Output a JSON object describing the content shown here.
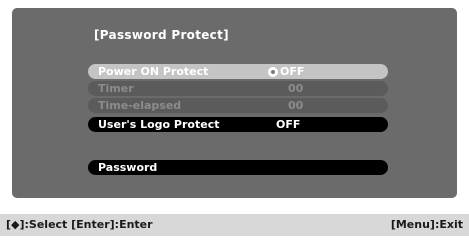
{
  "menu": {
    "title": "[Password Protect]",
    "items": [
      {
        "label": "Power ON Protect",
        "value": "OFF",
        "state": "selected",
        "icon": "cycle-icon"
      },
      {
        "label": "Timer",
        "value": "00",
        "state": "disabled"
      },
      {
        "label": "Time-elapsed",
        "value": "00",
        "state": "disabled"
      },
      {
        "label": "User's Logo Protect",
        "value": "OFF",
        "state": "active"
      },
      {
        "label": "Password",
        "value": "",
        "state": "active"
      }
    ]
  },
  "statusbar": {
    "left": "[◆]:Select [Enter]:Enter",
    "right": "[Menu]:Exit"
  },
  "colors": {
    "panel": "#6b6b6b",
    "selected_row": "#c4c4c4",
    "active_row": "#000000",
    "disabled_row": "#5b5b5b"
  }
}
